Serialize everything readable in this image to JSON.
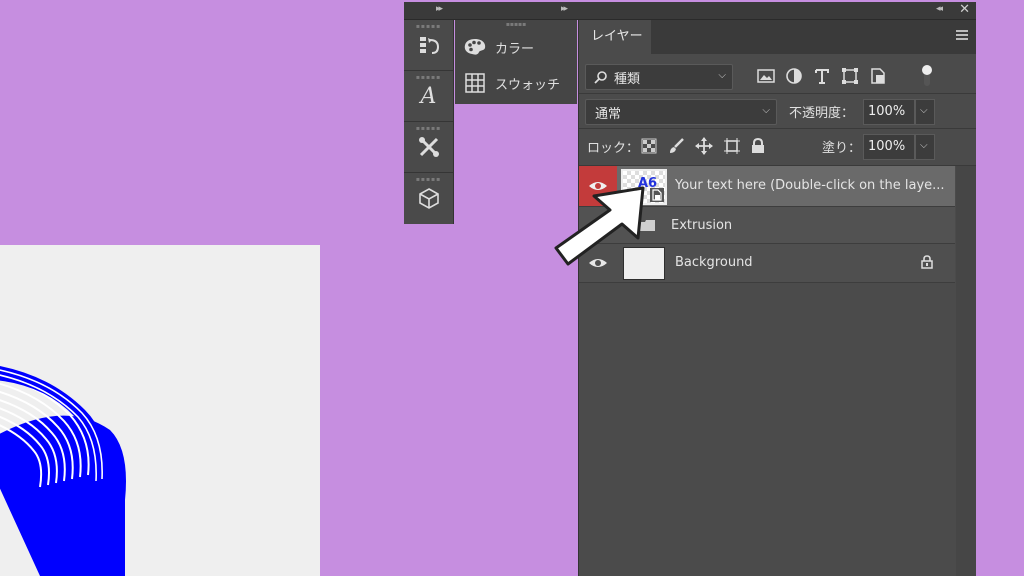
{
  "tools_panel": {
    "items": [
      {
        "icon": "history-icon"
      },
      {
        "icon": "character-icon",
        "glyph": "A"
      },
      {
        "icon": "tools-preset-icon"
      },
      {
        "icon": "3d-icon"
      }
    ]
  },
  "secondary_panel": {
    "items": [
      {
        "icon": "color-palette-icon",
        "label": "カラー"
      },
      {
        "icon": "swatches-grid-icon",
        "label": "スウォッチ"
      }
    ]
  },
  "layers_panel": {
    "tab_label": "レイヤー",
    "filter": {
      "value": "種類",
      "icons": [
        "image-filter-icon",
        "adjustment-filter-icon",
        "type-filter-icon",
        "shape-filter-icon",
        "smartobject-filter-icon"
      ]
    },
    "blend_mode": "通常",
    "opacity_label": "不透明度：",
    "opacity_value": "100%",
    "lock_label": "ロック：",
    "fill_label": "塗り：",
    "fill_value": "100%",
    "layers": [
      {
        "name": "Your text here (Double-click on the laye...",
        "thumb_glyph": "A6",
        "selected": true,
        "eye_bg": "#c33b3b"
      },
      {
        "name": "Extrusion",
        "kind": "folder"
      },
      {
        "name": "Background",
        "locked": true
      }
    ]
  },
  "colors": {
    "canvas_bg": "#c68ee0",
    "art_blue": "#0000ff",
    "selected_row": "#6a6a6a"
  }
}
